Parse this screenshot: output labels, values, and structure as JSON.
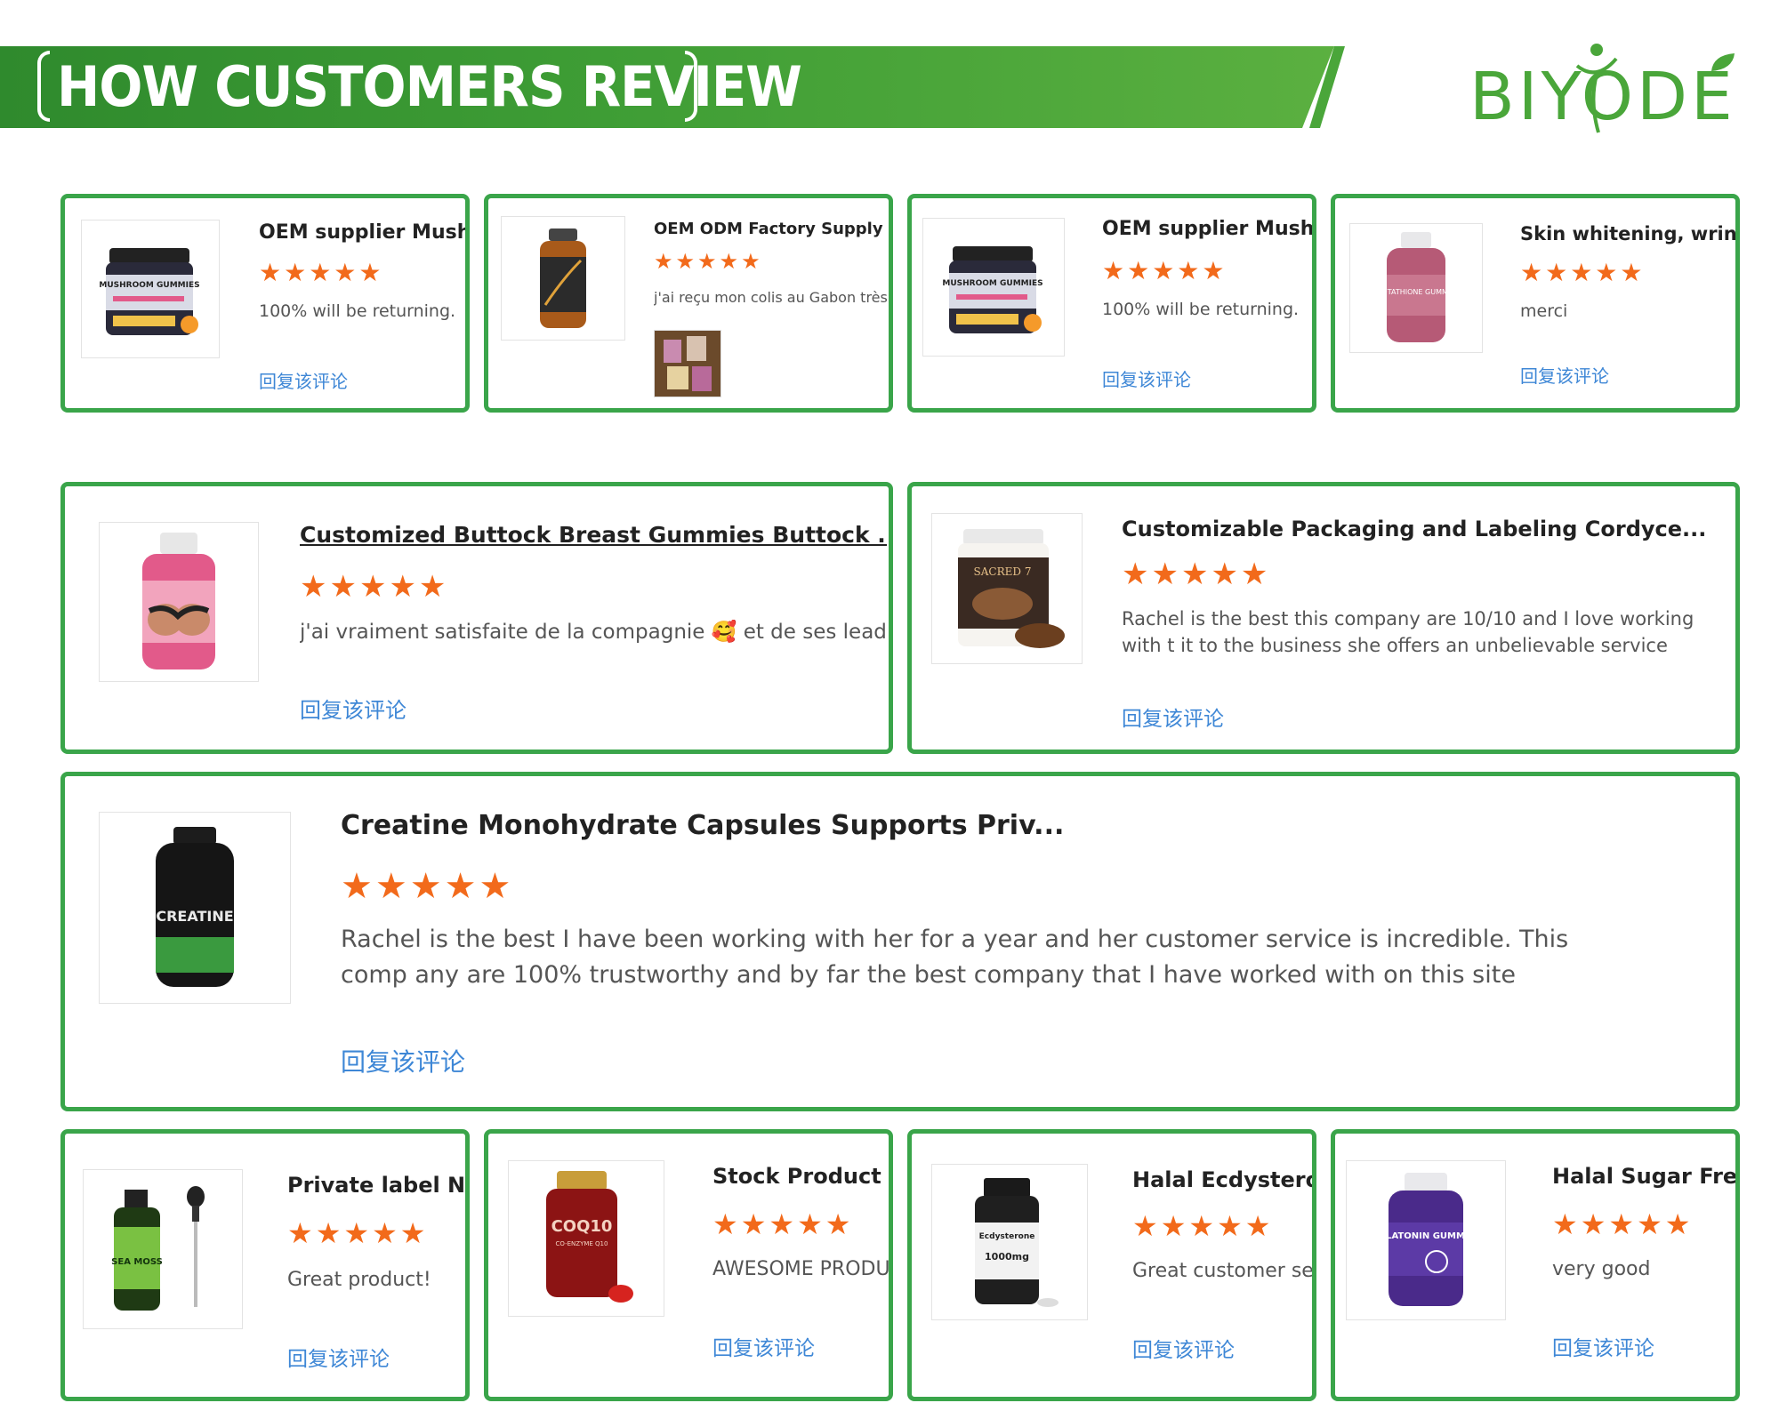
{
  "header": {
    "title": "HOW CUSTOMERS REVIEW",
    "logo_text": "BIYODE"
  },
  "colors": {
    "brand_green": "#3aa54a",
    "star_orange": "#f26a1b",
    "reply_blue": "#3e87d6"
  },
  "reviews": [
    {
      "title": "OEM supplier Mushro",
      "rating": 5,
      "text": "100% will be returning.",
      "reply": "回复该评论",
      "image": "mushroom-gummies-jar-icon"
    },
    {
      "title": "OEM ODM Factory Supply Big",
      "rating": 5,
      "text": "j'ai reçu mon colis au Gabon très s",
      "reply": "",
      "image": "amber-supplement-bottle-icon",
      "attachment": "package-photo-icon"
    },
    {
      "title": "OEM supplier Mushro",
      "rating": 5,
      "text": "100% will be returning.",
      "reply": "回复该评论",
      "image": "mushroom-gummies-jar-icon"
    },
    {
      "title": "Skin whitening, wrinkle r",
      "rating": 5,
      "text": "merci",
      "reply": "回复该评论",
      "image": "glutathione-gummies-bottle-icon"
    },
    {
      "title": "Customized Buttock Breast Gummies Buttock ...",
      "rating": 5,
      "text": "j'ai vraiment satisfaite de la compagnie 🥰 et de ses leaders",
      "reply": "回复该评论",
      "image": "gummies-bottle-icon"
    },
    {
      "title": "Customizable Packaging and Labeling Cordyce...",
      "rating": 5,
      "text": "Rachel is the best this company are 10/10 and I love working with t it to the business she offers an unbelievable service",
      "reply": "回复该评论",
      "image": "mushroom-powder-tub-icon"
    },
    {
      "title": "Creatine Monohydrate Capsules Supports Priv...",
      "rating": 5,
      "text": "Rachel is the best I have been working with her for a year and her customer service is incredible. This comp any are 100% trustworthy and by far the best company that I have worked with on this site",
      "reply": "回复该评论",
      "image": "creatine-bottle-icon"
    },
    {
      "title": "Private label Na",
      "rating": 5,
      "text": "Great product!",
      "reply": "回复该评论",
      "image": "sea-moss-dropper-bottle-icon"
    },
    {
      "title": "Stock Product C",
      "rating": 5,
      "text": "AWESOME PRODU",
      "reply": "回复该评论",
      "image": "coq10-bottle-icon"
    },
    {
      "title": "Halal Ecdystero",
      "rating": 5,
      "text": "Great customer se",
      "reply": "回复该评论",
      "image": "ecdysterone-bottle-icon"
    },
    {
      "title": "Halal Sugar Free",
      "rating": 5,
      "text": "very good",
      "reply": "回复该评论",
      "image": "melatonin-gummies-bottle-icon"
    }
  ],
  "product_labels": {
    "mushroom": "MUSHROOM GUMMIES",
    "glutathione": "GLUTATHIONE GUMMIES",
    "sacred": "SACRED 7",
    "creatine": "CREATINE",
    "sea_moss": "SEA MOSS",
    "coq10": "COQ10",
    "coq10_sub": "CO-ENZYME Q10",
    "ecdysterone": "Ecdysterone",
    "ecdysterone_dose": "1000mg",
    "melatonin": "MELATONIN GUMMIES"
  }
}
